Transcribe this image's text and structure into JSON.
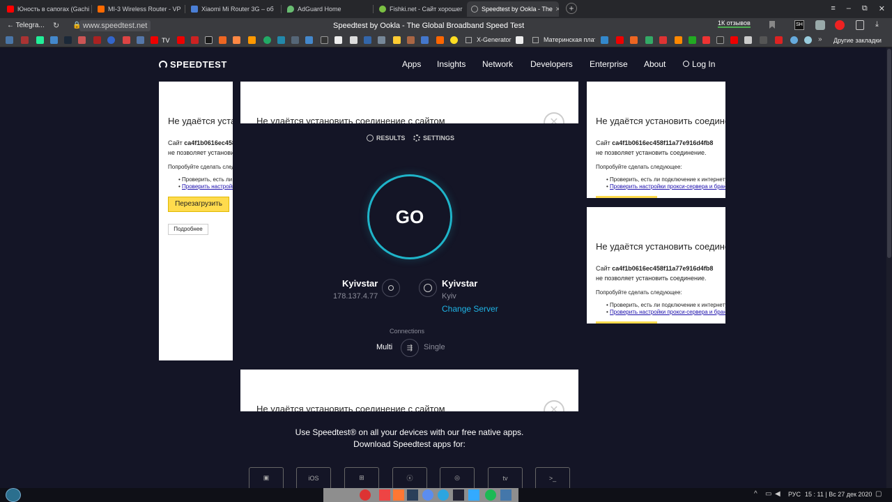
{
  "browser": {
    "tabs": [
      {
        "label": "Юность в сапогах (Gachi",
        "color": "#ff0000"
      },
      {
        "label": "MI-3 Wireless Router - VP",
        "color": "#ff6a00"
      },
      {
        "label": "Xiaomi Mi Router 3G – об",
        "color": "#4a7fd6"
      },
      {
        "label": "AdGuard Home",
        "color": "#68bc71"
      },
      {
        "label": "Fishki.net - Сайт хорошег",
        "color": "#7bc043"
      },
      {
        "label": "Speedtest by Ookla - The",
        "color": "#888888"
      }
    ],
    "new_tab": "+",
    "window_controls": {
      "minimize": "–",
      "maximize": "⧉",
      "close": "✕"
    },
    "menu": "≡",
    "back_label": "Telegra...",
    "url": "www.speedtest.net",
    "page_title": "Speedtest by Ookla - The Global Broadband Speed Test",
    "reviews_badge": "1К отзывов",
    "bookmarks": {
      "x_generator": "X-Generator",
      "mb": "Материнская плат",
      "other": "Другие закладки"
    }
  },
  "site": {
    "logo": "SPEEDTEST",
    "nav": {
      "apps": "Apps",
      "insights": "Insights",
      "network": "Network",
      "developers": "Developers",
      "enterprise": "Enterprise",
      "about": "About",
      "login": "Log In"
    },
    "tabs": {
      "results": "RESULTS",
      "settings": "SETTINGS"
    },
    "go": "GO",
    "isp": {
      "name": "Kyivstar",
      "ip": "178.137.4.77"
    },
    "server": {
      "name": "Kyivstar",
      "city": "Kyiv",
      "change": "Change Server"
    },
    "connections": {
      "label": "Connections",
      "multi": "Multi",
      "single": "Single"
    },
    "promo": {
      "line1": "Use Speedtest® on all your devices with our free native apps.",
      "line2": "Download Speedtest apps for:"
    },
    "apps": [
      "android",
      "iOS",
      "windows",
      "mac",
      "chrome",
      "tv",
      "cli"
    ]
  },
  "error_ad": {
    "title": "Не удаётся установить соединение с сайтом",
    "site_prefix": "Сайт",
    "site_id": "ca4f1b0616ec458f11a77e916d4fb8",
    "cannot": "не позволяет установить соединение.",
    "try": "Попробуйте сделать следующее:",
    "item1": "Проверить, есть ли подключение к интернету",
    "item2": "Проверить настройки прокси-сервера и брандмауэра",
    "reload": "Перезагрузить",
    "more": "Подробнее"
  },
  "tray": {
    "lang": "РУС",
    "clock": "15 : 11 | Вс 27 дек 2020"
  }
}
